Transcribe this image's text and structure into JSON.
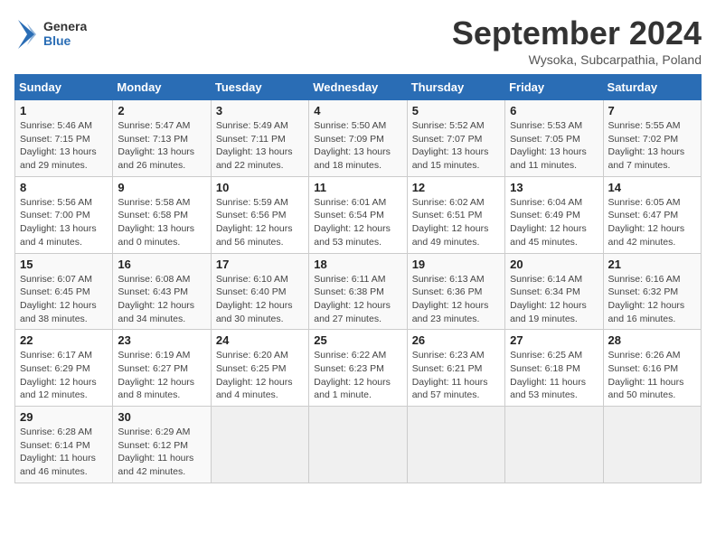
{
  "header": {
    "logo_line1": "General",
    "logo_line2": "Blue",
    "month_title": "September 2024",
    "subtitle": "Wysoka, Subcarpathia, Poland"
  },
  "days_of_week": [
    "Sunday",
    "Monday",
    "Tuesday",
    "Wednesday",
    "Thursday",
    "Friday",
    "Saturday"
  ],
  "weeks": [
    [
      {
        "day": "1",
        "info": "Sunrise: 5:46 AM\nSunset: 7:15 PM\nDaylight: 13 hours\nand 29 minutes."
      },
      {
        "day": "2",
        "info": "Sunrise: 5:47 AM\nSunset: 7:13 PM\nDaylight: 13 hours\nand 26 minutes."
      },
      {
        "day": "3",
        "info": "Sunrise: 5:49 AM\nSunset: 7:11 PM\nDaylight: 13 hours\nand 22 minutes."
      },
      {
        "day": "4",
        "info": "Sunrise: 5:50 AM\nSunset: 7:09 PM\nDaylight: 13 hours\nand 18 minutes."
      },
      {
        "day": "5",
        "info": "Sunrise: 5:52 AM\nSunset: 7:07 PM\nDaylight: 13 hours\nand 15 minutes."
      },
      {
        "day": "6",
        "info": "Sunrise: 5:53 AM\nSunset: 7:05 PM\nDaylight: 13 hours\nand 11 minutes."
      },
      {
        "day": "7",
        "info": "Sunrise: 5:55 AM\nSunset: 7:02 PM\nDaylight: 13 hours\nand 7 minutes."
      }
    ],
    [
      {
        "day": "8",
        "info": "Sunrise: 5:56 AM\nSunset: 7:00 PM\nDaylight: 13 hours\nand 4 minutes."
      },
      {
        "day": "9",
        "info": "Sunrise: 5:58 AM\nSunset: 6:58 PM\nDaylight: 13 hours\nand 0 minutes."
      },
      {
        "day": "10",
        "info": "Sunrise: 5:59 AM\nSunset: 6:56 PM\nDaylight: 12 hours\nand 56 minutes."
      },
      {
        "day": "11",
        "info": "Sunrise: 6:01 AM\nSunset: 6:54 PM\nDaylight: 12 hours\nand 53 minutes."
      },
      {
        "day": "12",
        "info": "Sunrise: 6:02 AM\nSunset: 6:51 PM\nDaylight: 12 hours\nand 49 minutes."
      },
      {
        "day": "13",
        "info": "Sunrise: 6:04 AM\nSunset: 6:49 PM\nDaylight: 12 hours\nand 45 minutes."
      },
      {
        "day": "14",
        "info": "Sunrise: 6:05 AM\nSunset: 6:47 PM\nDaylight: 12 hours\nand 42 minutes."
      }
    ],
    [
      {
        "day": "15",
        "info": "Sunrise: 6:07 AM\nSunset: 6:45 PM\nDaylight: 12 hours\nand 38 minutes."
      },
      {
        "day": "16",
        "info": "Sunrise: 6:08 AM\nSunset: 6:43 PM\nDaylight: 12 hours\nand 34 minutes."
      },
      {
        "day": "17",
        "info": "Sunrise: 6:10 AM\nSunset: 6:40 PM\nDaylight: 12 hours\nand 30 minutes."
      },
      {
        "day": "18",
        "info": "Sunrise: 6:11 AM\nSunset: 6:38 PM\nDaylight: 12 hours\nand 27 minutes."
      },
      {
        "day": "19",
        "info": "Sunrise: 6:13 AM\nSunset: 6:36 PM\nDaylight: 12 hours\nand 23 minutes."
      },
      {
        "day": "20",
        "info": "Sunrise: 6:14 AM\nSunset: 6:34 PM\nDaylight: 12 hours\nand 19 minutes."
      },
      {
        "day": "21",
        "info": "Sunrise: 6:16 AM\nSunset: 6:32 PM\nDaylight: 12 hours\nand 16 minutes."
      }
    ],
    [
      {
        "day": "22",
        "info": "Sunrise: 6:17 AM\nSunset: 6:29 PM\nDaylight: 12 hours\nand 12 minutes."
      },
      {
        "day": "23",
        "info": "Sunrise: 6:19 AM\nSunset: 6:27 PM\nDaylight: 12 hours\nand 8 minutes."
      },
      {
        "day": "24",
        "info": "Sunrise: 6:20 AM\nSunset: 6:25 PM\nDaylight: 12 hours\nand 4 minutes."
      },
      {
        "day": "25",
        "info": "Sunrise: 6:22 AM\nSunset: 6:23 PM\nDaylight: 12 hours\nand 1 minute."
      },
      {
        "day": "26",
        "info": "Sunrise: 6:23 AM\nSunset: 6:21 PM\nDaylight: 11 hours\nand 57 minutes."
      },
      {
        "day": "27",
        "info": "Sunrise: 6:25 AM\nSunset: 6:18 PM\nDaylight: 11 hours\nand 53 minutes."
      },
      {
        "day": "28",
        "info": "Sunrise: 6:26 AM\nSunset: 6:16 PM\nDaylight: 11 hours\nand 50 minutes."
      }
    ],
    [
      {
        "day": "29",
        "info": "Sunrise: 6:28 AM\nSunset: 6:14 PM\nDaylight: 11 hours\nand 46 minutes."
      },
      {
        "day": "30",
        "info": "Sunrise: 6:29 AM\nSunset: 6:12 PM\nDaylight: 11 hours\nand 42 minutes."
      },
      {
        "day": "",
        "info": ""
      },
      {
        "day": "",
        "info": ""
      },
      {
        "day": "",
        "info": ""
      },
      {
        "day": "",
        "info": ""
      },
      {
        "day": "",
        "info": ""
      }
    ]
  ]
}
